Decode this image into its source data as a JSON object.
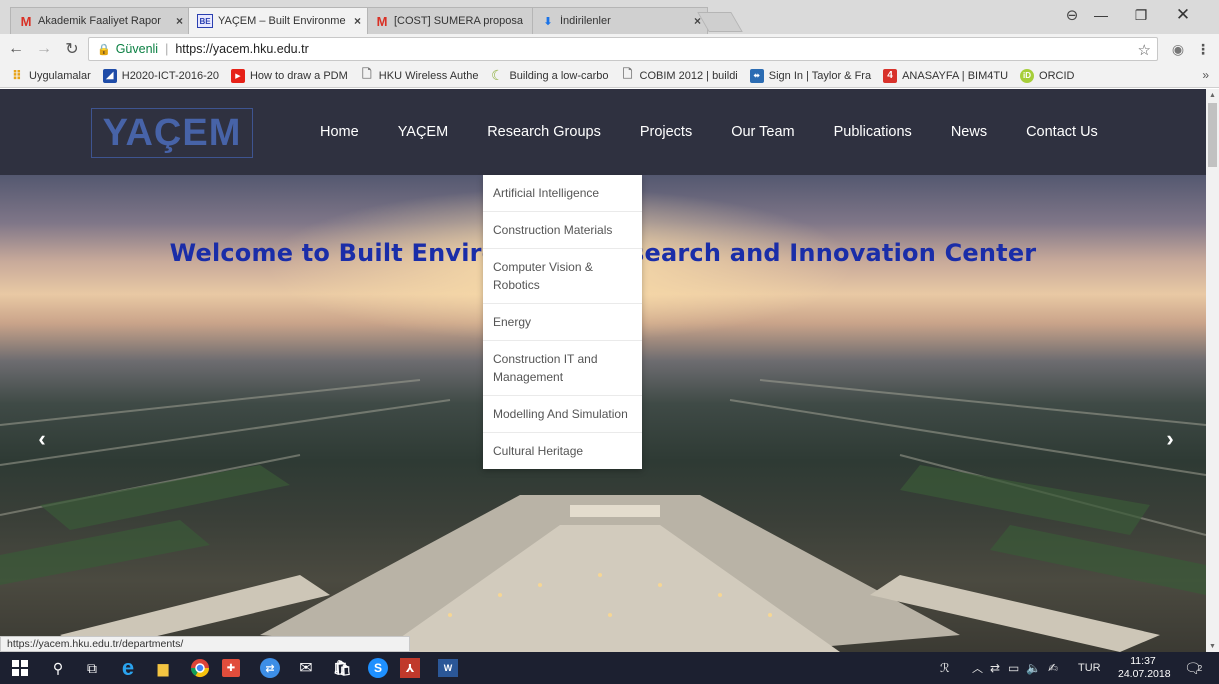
{
  "browser": {
    "tabs": [
      {
        "title": "Akademik Faaliyet Rapor",
        "favicon": "gmail-icon",
        "active": false
      },
      {
        "title": "YAÇEM – Built Environme",
        "favicon": "site-icon",
        "active": true
      },
      {
        "title": "[COST] SUMERA proposa",
        "favicon": "gmail-icon",
        "active": false
      },
      {
        "title": "İndirilenler",
        "favicon": "download-icon",
        "active": false
      }
    ],
    "address": {
      "secure_label": "Güvenli",
      "url": "https://yacem.hku.edu.tr"
    },
    "bookmarks": [
      {
        "label": "Uygulamalar",
        "icon": "apps-icon",
        "color": "#e8a317"
      },
      {
        "label": "H2020-ICT-2016-20",
        "icon": "eu-icon",
        "color": "#1f4ca8"
      },
      {
        "label": "How to draw a PDM",
        "icon": "youtube-icon",
        "color": "#e62117"
      },
      {
        "label": "HKU Wireless Authe",
        "icon": "page-icon",
        "color": "#777777"
      },
      {
        "label": "Building a low-carbo",
        "icon": "crescent-icon",
        "color": "#8dae3c"
      },
      {
        "label": "COBIM 2012 | buildi",
        "icon": "page-icon",
        "color": "#777777"
      },
      {
        "label": "Sign In | Taylor & Fra",
        "icon": "taylor-icon",
        "color": "#2b6cb3"
      },
      {
        "label": "ANASAYFA | BIM4TU",
        "icon": "four-icon",
        "color": "#d8322b"
      },
      {
        "label": "ORCID",
        "icon": "orcid-icon",
        "color": "#a6ce39"
      }
    ],
    "status_url": "https://yacem.hku.edu.tr/departments/"
  },
  "site": {
    "logo": "YAÇEM",
    "menu": [
      "Home",
      "YAÇEM",
      "Research Groups",
      "Projects",
      "Our Team",
      "Publications",
      "News",
      "Contact Us"
    ],
    "hero_title": "Welcome to Built Environment Research and Innovation Center",
    "dropdown": [
      "Artificial Intelligence",
      "Construction Materials",
      "Computer Vision & Robotics",
      "Energy",
      "Construction IT and Management",
      "Modelling And Simulation",
      "Cultural Heritage"
    ]
  },
  "taskbar": {
    "language": "TUR",
    "time": "11:37",
    "date": "24.07.2018",
    "notifications": "2"
  }
}
